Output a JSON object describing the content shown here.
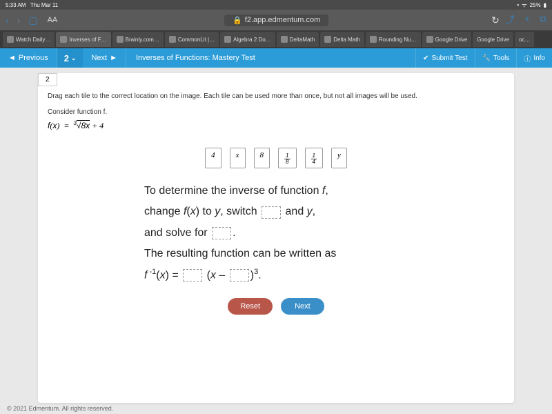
{
  "status": {
    "time": "5:33 AM",
    "date": "Thu Mar 11",
    "battery": "25%"
  },
  "browser": {
    "url": "f2.app.edmentum.com",
    "aa": "AA",
    "share": "⤴",
    "plus": "+",
    "copy": "⧉"
  },
  "tabs": [
    {
      "label": "Watch Daily…"
    },
    {
      "label": "Inverses of F…"
    },
    {
      "label": "Brainly.com…"
    },
    {
      "label": "CommonLit |…"
    },
    {
      "label": "Algebra 2 Do…"
    },
    {
      "label": "DeltaMath"
    },
    {
      "label": "Delta Math"
    },
    {
      "label": "Rounding Nu…"
    },
    {
      "label": "Google Drive"
    },
    {
      "label": "Google Drive"
    },
    {
      "label": "oc…"
    }
  ],
  "header": {
    "previous": "Previous",
    "q_number": "2",
    "next": "Next",
    "title": "Inverses of Functions: Mastery Test",
    "submit": "Submit Test",
    "tools": "Tools",
    "info": "Info"
  },
  "question": {
    "tab_num": "2",
    "instruction": "Drag each tile to the correct location on the image. Each tile can be used more than once, but not all images will be used.",
    "consider": "Consider function f.",
    "tiles": {
      "t1": "4",
      "t2": "x",
      "t3": "8",
      "t4_num": "1",
      "t4_den": "8",
      "t5_num": "1",
      "t5_den": "4",
      "t6": "y"
    },
    "line1_a": "To determine the inverse of function ",
    "line1_b": "f",
    "line1_c": ",",
    "line2_a": "change ",
    "line2_b": "f",
    "line2_c": "(",
    "line2_d": "x",
    "line2_e": ") to ",
    "line2_f": "y",
    "line2_g": ", switch ",
    "line2_h": " and ",
    "line2_i": "y",
    "line2_j": ",",
    "line3_a": "and solve for ",
    "line3_b": ".",
    "line4": "The resulting function can be written as",
    "line5_a": "f",
    "line5_b": " -1",
    "line5_c": "(",
    "line5_d": "x",
    "line5_e": ") = ",
    "line5_f": " (",
    "line5_g": "x",
    "line5_h": " – ",
    "line5_i": ")",
    "line5_j": "3",
    "line5_k": "."
  },
  "actions": {
    "reset": "Reset",
    "next": "Next"
  },
  "footer": "© 2021 Edmentum. All rights reserved."
}
